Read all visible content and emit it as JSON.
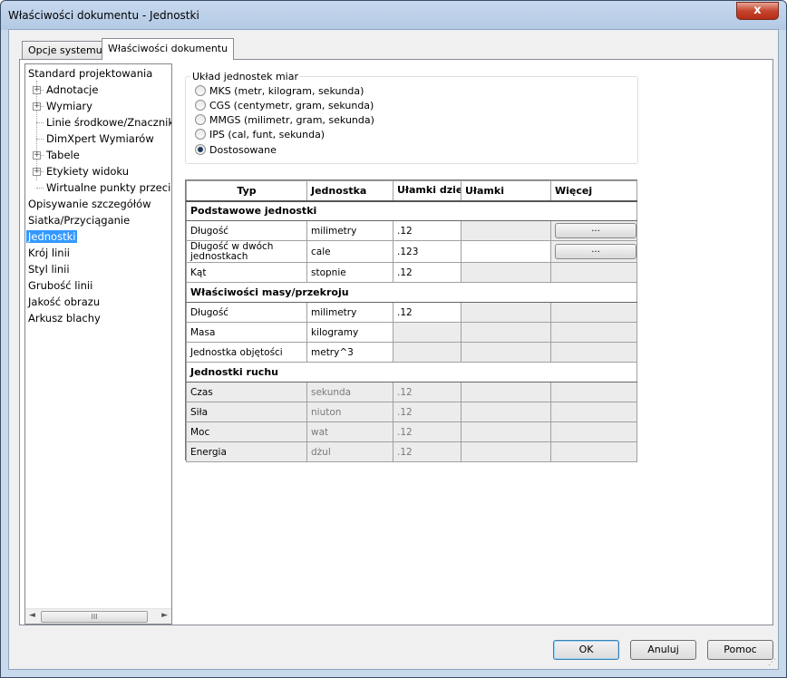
{
  "window": {
    "title": "Właściwości dokumentu - Jednostki",
    "close_glyph": "x"
  },
  "tabs": [
    {
      "label": "Opcje systemu"
    },
    {
      "label": "Właściwości dokumentu"
    }
  ],
  "tree": {
    "items": [
      {
        "label": "Standard projektowania"
      },
      {
        "label": "Adnotacje"
      },
      {
        "label": "Wymiary"
      },
      {
        "label": "Linie środkowe/Znaczniki"
      },
      {
        "label": "DimXpert Wymiarów"
      },
      {
        "label": "Tabele"
      },
      {
        "label": "Etykiety widoku"
      },
      {
        "label": "Wirtualne punkty przecięcia"
      },
      {
        "label": "Opisywanie szczegółów"
      },
      {
        "label": "Siatka/Przyciąganie"
      },
      {
        "label": "Jednostki"
      },
      {
        "label": "Krój linii"
      },
      {
        "label": "Styl linii"
      },
      {
        "label": "Grubość linii"
      },
      {
        "label": "Jakość obrazu"
      },
      {
        "label": "Arkusz blachy"
      }
    ],
    "expand_glyph": "+",
    "scroll_left": "◄",
    "scroll_right": "►",
    "thumb_grip": "III"
  },
  "unit_system": {
    "legend": "Układ jednostek miar",
    "options": [
      {
        "label": "MKS  (metr, kilogram, sekunda)",
        "selected": false
      },
      {
        "label": "CGS  (centymetr, gram, sekunda)",
        "selected": false
      },
      {
        "label": "MMGS  (milimetr, gram, sekunda)",
        "selected": false
      },
      {
        "label": "IPS  (cal, funt, sekunda)",
        "selected": false
      },
      {
        "label": "Dostosowane",
        "selected": true
      }
    ]
  },
  "grid": {
    "headers": [
      "Typ",
      "Jednostka",
      "Ułamki dziesiętne",
      "Ułamki",
      "Więcej"
    ],
    "sections": [
      {
        "title": "Podstawowe jednostki"
      },
      {
        "title": "Właściwości masy/przekroju"
      },
      {
        "title": "Jednostki ruchu"
      }
    ],
    "rows": [
      {
        "type": "Długość",
        "unit": "milimetry",
        "decimals": ".12",
        "fractions": "",
        "more": "..."
      },
      {
        "type": "Długość w dwóch jednostkach",
        "unit": "cale",
        "decimals": ".123",
        "fractions": "",
        "more": "..."
      },
      {
        "type": "Kąt",
        "unit": "stopnie",
        "decimals": ".12",
        "fractions": "",
        "more": ""
      },
      {
        "type": "Długość",
        "unit": "milimetry",
        "decimals": ".12",
        "fractions": "",
        "more": ""
      },
      {
        "type": "Masa",
        "unit": "kilogramy",
        "decimals": "",
        "fractions": "",
        "more": ""
      },
      {
        "type": "Jednostka objętości",
        "unit": "metry^3",
        "decimals": "",
        "fractions": "",
        "more": ""
      },
      {
        "type": "Czas",
        "unit": "sekunda",
        "decimals": ".12",
        "fractions": "",
        "more": ""
      },
      {
        "type": "Siła",
        "unit": "niuton",
        "decimals": ".12",
        "fractions": "",
        "more": ""
      },
      {
        "type": "Moc",
        "unit": "wat",
        "decimals": ".12",
        "fractions": "",
        "more": ""
      },
      {
        "type": "Energia",
        "unit": "dżul",
        "decimals": ".12",
        "fractions": "",
        "more": ""
      }
    ]
  },
  "buttons": {
    "ok": "OK",
    "cancel": "Anuluj",
    "help": "Pomoc"
  },
  "colors": {
    "selection": "#3399ff",
    "titlebar": "#c6d8ee",
    "close": "#c6452e"
  }
}
